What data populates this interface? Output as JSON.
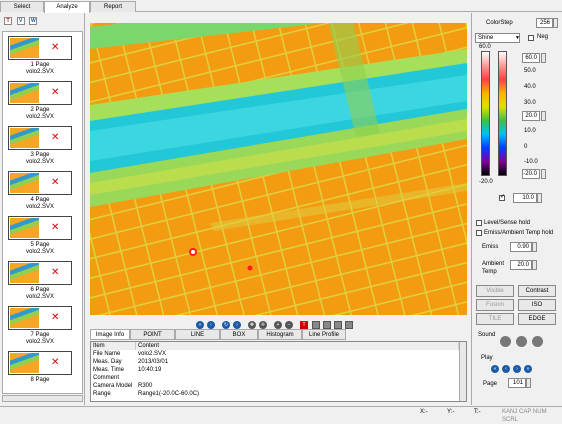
{
  "tabs": [
    {
      "label": "Select"
    },
    {
      "label": "Analyze"
    },
    {
      "label": "Report"
    }
  ],
  "left": {
    "tool_icons": [
      "T",
      "V",
      "W"
    ],
    "thumbnails": [
      {
        "page": "1 Page",
        "file": "volo2.SVX"
      },
      {
        "page": "2 Page",
        "file": "volo2.SVX"
      },
      {
        "page": "3 Page",
        "file": "volo2.SVX"
      },
      {
        "page": "4 Page",
        "file": "volo2.SVX"
      },
      {
        "page": "5 Page",
        "file": "volo2.SVX"
      },
      {
        "page": "6 Page",
        "file": "volo2.SVX"
      },
      {
        "page": "7 Page",
        "file": "volo2.SVX"
      },
      {
        "page": "8 Page",
        "file": ""
      }
    ]
  },
  "info_tabs": [
    {
      "label": "Image Info"
    },
    {
      "label": "POINT"
    },
    {
      "label": "LINE"
    },
    {
      "label": "BOX"
    },
    {
      "label": "Histogram"
    },
    {
      "label": "Line Profile"
    }
  ],
  "info_table": {
    "columns": [
      "Item",
      "Content"
    ],
    "rows": [
      {
        "item": "File Name",
        "content": "volo2.SVX"
      },
      {
        "item": "Meas. Day",
        "content": "2013/03/01"
      },
      {
        "item": "Meas. Time",
        "content": "10:40:19"
      },
      {
        "item": "Comment",
        "content": ""
      },
      {
        "item": "Camera Model",
        "content": "R300"
      },
      {
        "item": "Range",
        "content": "Range1(-20.0C-60.0C)"
      }
    ]
  },
  "right": {
    "colorstep_label": "ColorStep",
    "colorstep_value": "256",
    "palette": "Shine",
    "neg_label": "Neg",
    "scale_top": "60.0",
    "scale_bottom": "-20.0",
    "scale_values": [
      "60.0",
      "50.0",
      "40.0",
      "30.0",
      "20.0",
      "10.0",
      "0",
      "-10.0",
      "-20.0"
    ],
    "lower_value": "10.0",
    "level_hold": "Level/Sense hold",
    "emiss_hold": "Emiss/Ambient Temp hold",
    "emiss_label": "Emiss",
    "emiss_value": "0.90",
    "ambient_label": "Ambient Temp",
    "ambient_value": "20.0",
    "buttons": {
      "visible": "Visible",
      "contrast": "Contrast",
      "fusion": "Fusion",
      "iso": "ISO",
      "tile": "TILE",
      "edge": "EDGE"
    },
    "sound_label": "Sound",
    "play_label": "Play",
    "page_label": "Page",
    "page_value": "101"
  },
  "status": {
    "x": "X:-",
    "y": "Y:-",
    "t": "T:-",
    "flags": "KANJ CAP NUM SCRL"
  }
}
